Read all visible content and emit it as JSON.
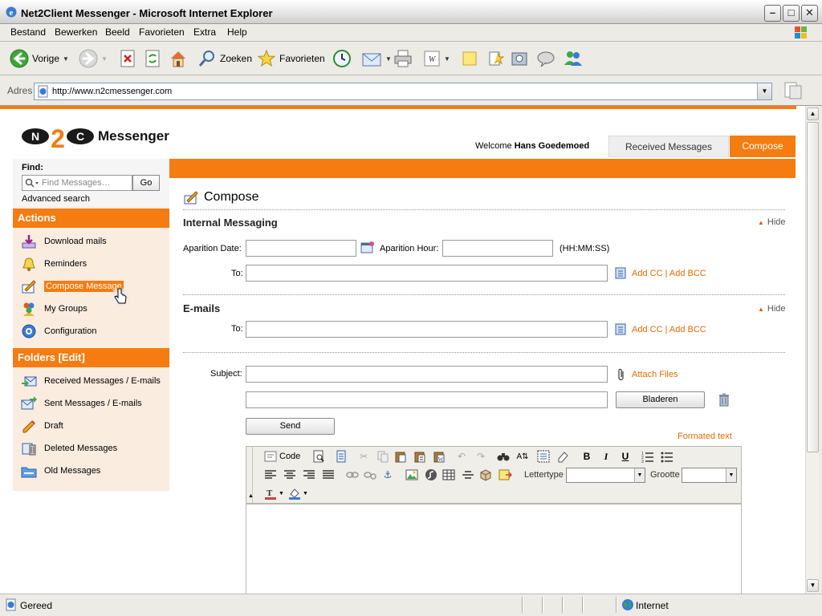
{
  "window": {
    "title": "Net2Client Messenger - Microsoft Internet Explorer"
  },
  "menu": [
    "Bestand",
    "Bewerken",
    "Beeld",
    "Favorieten",
    "Extra",
    "Help"
  ],
  "toolbar": {
    "back_label": "Vorige",
    "search_label": "Zoeken",
    "favorites_label": "Favorieten"
  },
  "address": {
    "label": "Adres",
    "url": "http://www.n2cmessenger.com"
  },
  "header": {
    "brand": "Messenger",
    "welcome_prefix": "Welcome",
    "user_name": "Hans Goedemoed",
    "tabs": [
      {
        "label": "Received Messages",
        "active": false
      },
      {
        "label": "Compose",
        "active": true
      }
    ]
  },
  "sidebar": {
    "find_label": "Find:",
    "search_placeholder": "Find Messages…",
    "go_label": "Go",
    "advanced_search": "Advanced search",
    "actions_title": "Actions",
    "actions": [
      {
        "label": "Download mails",
        "icon": "download-icon"
      },
      {
        "label": "Reminders",
        "icon": "reminder-icon"
      },
      {
        "label": "Compose Message",
        "icon": "compose-icon",
        "selected": true
      },
      {
        "label": "My Groups",
        "icon": "groups-icon"
      },
      {
        "label": "Configuration",
        "icon": "gear-icon"
      }
    ],
    "folders_title": "Folders [Edit]",
    "folders": [
      {
        "label": "Received Messages / E-mails",
        "icon": "inbox-icon"
      },
      {
        "label": "Sent Messages / E-mails",
        "icon": "sent-icon"
      },
      {
        "label": "Draft",
        "icon": "draft-icon"
      },
      {
        "label": "Deleted Messages",
        "icon": "trash-icon"
      },
      {
        "label": "Old Messages",
        "icon": "archive-icon"
      }
    ]
  },
  "compose": {
    "title": "Compose",
    "internal_title": "Internal Messaging",
    "hide_label": "Hide",
    "aparition_date_label": "Aparition Date:",
    "aparition_hour_label": "Aparition Hour:",
    "hour_format": "(HH:MM:SS)",
    "to_label": "To:",
    "add_cc_bcc": "Add CC | Add BCC",
    "emails_title": "E-mails",
    "subject_label": "Subject:",
    "attach_files": "Attach Files",
    "browse_label": "Bladeren",
    "send_label": "Send",
    "formatted_text": "Formated text"
  },
  "editor": {
    "code_label": "Code",
    "font_label": "Lettertype",
    "size_label": "Grootte"
  },
  "status": {
    "text": "Gereed",
    "zone": "Internet"
  },
  "colors": {
    "accent": "#f47c10",
    "sidebar_bg": "#fbece0",
    "link": "#e06d00"
  }
}
